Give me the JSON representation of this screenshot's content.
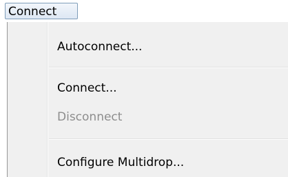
{
  "menubar": {
    "title": "Connect"
  },
  "menu": {
    "items": [
      {
        "label": "Autoconnect...",
        "enabled": true
      },
      {
        "label": "Connect...",
        "enabled": true
      },
      {
        "label": "Disconnect",
        "enabled": false
      },
      {
        "label": "Configure Multidrop...",
        "enabled": true
      }
    ]
  }
}
